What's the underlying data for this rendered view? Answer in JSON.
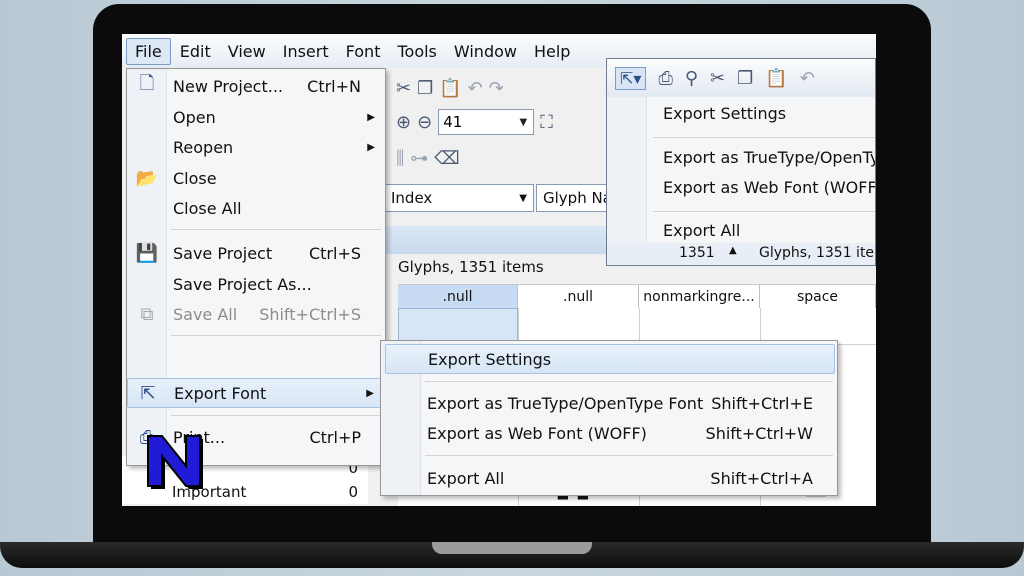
{
  "menubar": {
    "items": [
      "File",
      "Edit",
      "View",
      "Insert",
      "Font",
      "Tools",
      "Window",
      "Help"
    ]
  },
  "toolbar": {
    "zoom_value": "41",
    "index_combo": "Index",
    "glyph_name_combo": "Glyph Na"
  },
  "grid": {
    "title": "Glyphs, 1351 items",
    "headers": [
      ".null",
      ".null",
      "nonmarkingre...",
      "space"
    ]
  },
  "sidebar": {
    "important_label": "Important",
    "important_count": "0",
    "upper_count": "0"
  },
  "file_menu": {
    "items": [
      {
        "label": "New Project...",
        "shortcut": "Ctrl+N",
        "icon": "new-document-icon"
      },
      {
        "label": "Open",
        "submenu": true
      },
      {
        "label": "Reopen",
        "submenu": true
      },
      {
        "label": "Close",
        "icon": "folder-icon"
      },
      {
        "label": "Close All"
      },
      {
        "label": "Save Project",
        "shortcut": "Ctrl+S",
        "icon": "floppy-disk-icon"
      },
      {
        "label": "Save Project As..."
      },
      {
        "label": "Save All",
        "shortcut": "Shift+Ctrl+S",
        "disabled": true,
        "icon": "save-all-icon"
      },
      {
        "label": "Export Font",
        "submenu": true,
        "icon": "export-font-icon"
      },
      {
        "label": "Print...",
        "shortcut": "Ctrl+P",
        "icon": "printer-icon"
      }
    ]
  },
  "export_menu": {
    "items": [
      {
        "label": "Export Settings"
      },
      {
        "label": "Export as TrueType/OpenType Font",
        "shortcut": "Shift+Ctrl+E"
      },
      {
        "label": "Export as Web Font (WOFF)",
        "shortcut": "Shift+Ctrl+W"
      },
      {
        "label": "Export All",
        "shortcut": "Shift+Ctrl+A"
      }
    ]
  },
  "inset_menu": {
    "items": [
      "Export Settings",
      "Export as TrueType/OpenTyp",
      "Export as Web Font (WOFF)",
      "Export All"
    ],
    "bottom_count": "1351",
    "bottom_label": "Glyphs, 1351 ite"
  },
  "colors": {
    "highlight": "#d6e5f5",
    "logo_blue": "#1f1bd6",
    "menu_bg": "#f4f6f8"
  }
}
